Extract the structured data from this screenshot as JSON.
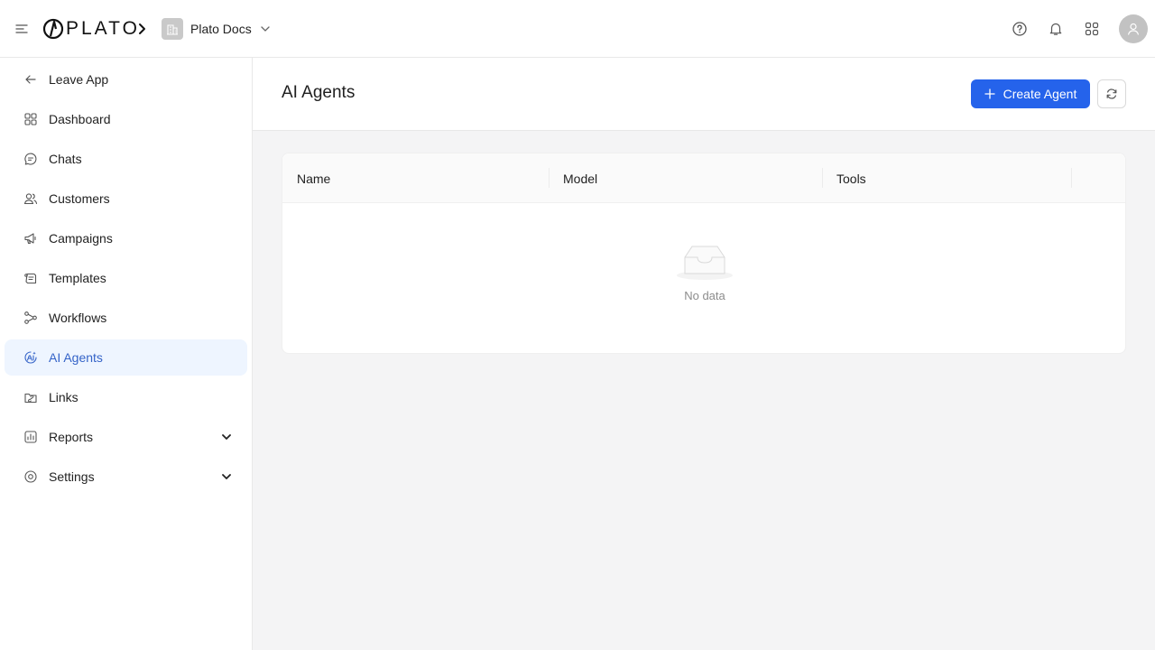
{
  "header": {
    "brand": "PLATO",
    "workspace": "Plato Docs"
  },
  "sidebar": {
    "items": [
      {
        "label": "Leave App",
        "icon": "arrow-left-icon"
      },
      {
        "label": "Dashboard",
        "icon": "dashboard-icon"
      },
      {
        "label": "Chats",
        "icon": "chat-icon"
      },
      {
        "label": "Customers",
        "icon": "users-icon"
      },
      {
        "label": "Campaigns",
        "icon": "megaphone-icon"
      },
      {
        "label": "Templates",
        "icon": "template-icon"
      },
      {
        "label": "Workflows",
        "icon": "workflow-icon"
      },
      {
        "label": "AI Agents",
        "icon": "ai-agent-icon",
        "active": true
      },
      {
        "label": "Links",
        "icon": "link-icon"
      },
      {
        "label": "Reports",
        "icon": "report-icon",
        "expandable": true
      },
      {
        "label": "Settings",
        "icon": "settings-icon",
        "expandable": true
      }
    ]
  },
  "main": {
    "title": "AI Agents",
    "create_button": "Create Agent",
    "table": {
      "columns": [
        "Name",
        "Model",
        "Tools"
      ],
      "empty_text": "No data"
    }
  },
  "colors": {
    "primary": "#2563eb",
    "active_bg": "#eef5ff",
    "active_text": "#3463c8",
    "main_bg": "#f4f4f5"
  }
}
